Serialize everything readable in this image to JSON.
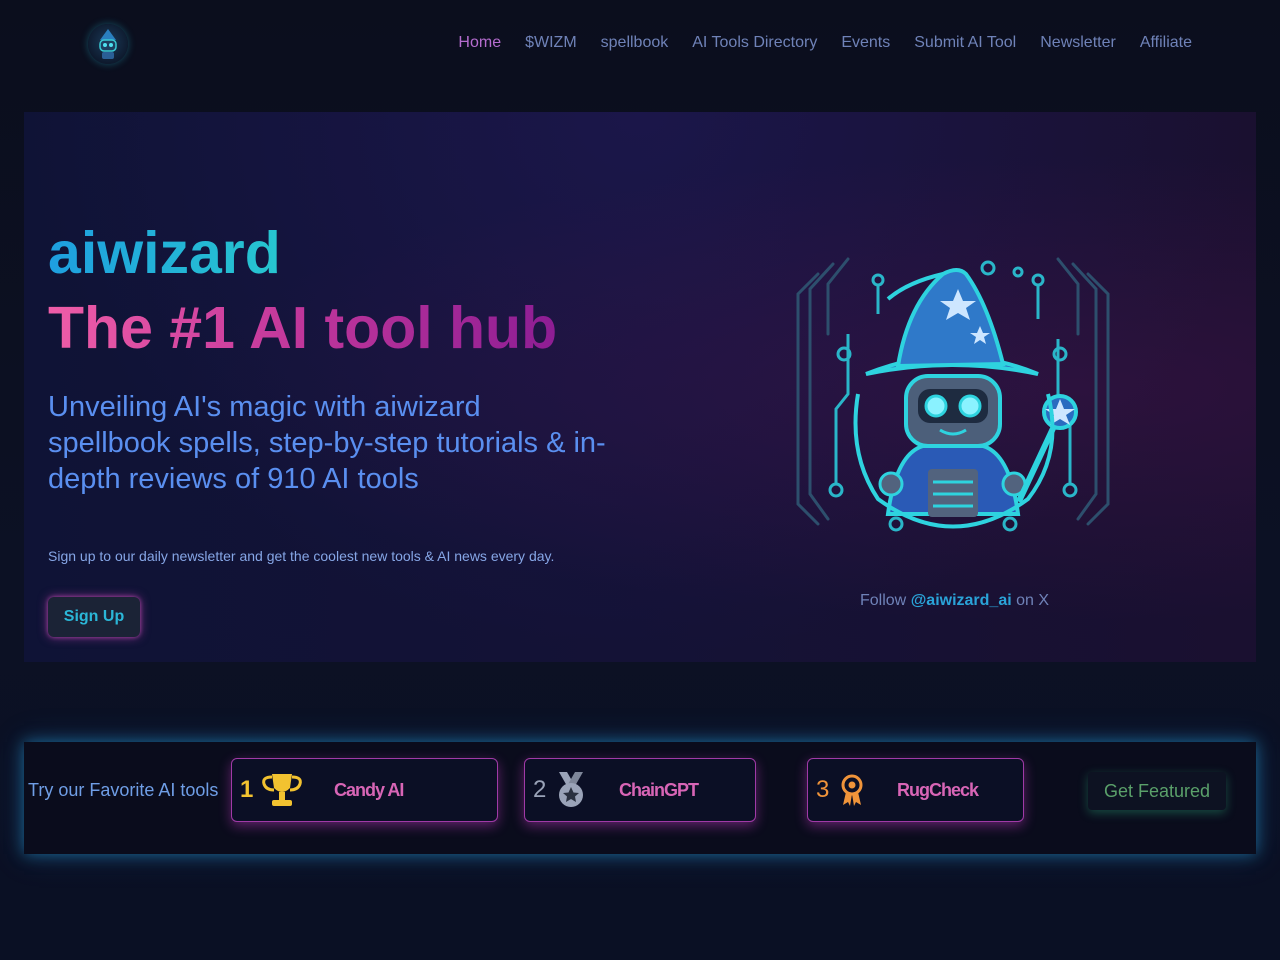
{
  "nav": {
    "items": [
      "Home",
      "$WIZM",
      "spellbook",
      "AI Tools Directory",
      "Events",
      "Submit AI Tool",
      "Newsletter",
      "Affiliate"
    ],
    "active": "Home"
  },
  "hero": {
    "brand": "aiwizard",
    "title": "The #1 AI tool hub",
    "subtitle": "Unveiling AI's magic with aiwizard spellbook spells, step-by-step tutorials & in-depth reviews of 910 AI tools",
    "note": "Sign up to our daily newsletter and get the coolest new tools & AI news every day.",
    "signup_label": "Sign Up",
    "follow_prefix": "Follow ",
    "follow_handle": "@aiwizard_ai",
    "follow_suffix": " on X"
  },
  "favorites": {
    "label": "Try our Favorite AI tools",
    "cards": [
      {
        "rank": "1",
        "name": "Candy AI",
        "icon": "trophy-icon",
        "rank_color": "#f2c230"
      },
      {
        "rank": "2",
        "name": "ChainGPT",
        "icon": "silver-medal-icon",
        "rank_color": "#9aa3b8"
      },
      {
        "rank": "3",
        "name": "RugCheck",
        "icon": "bronze-award-icon",
        "rank_color": "#f0943a"
      }
    ],
    "cta_label": "Get Featured"
  },
  "colors": {
    "accent_cyan": "#27c6cf",
    "accent_pink": "#d865b6",
    "nav_text": "#6f82b8",
    "nav_active": "#b56ccf"
  }
}
